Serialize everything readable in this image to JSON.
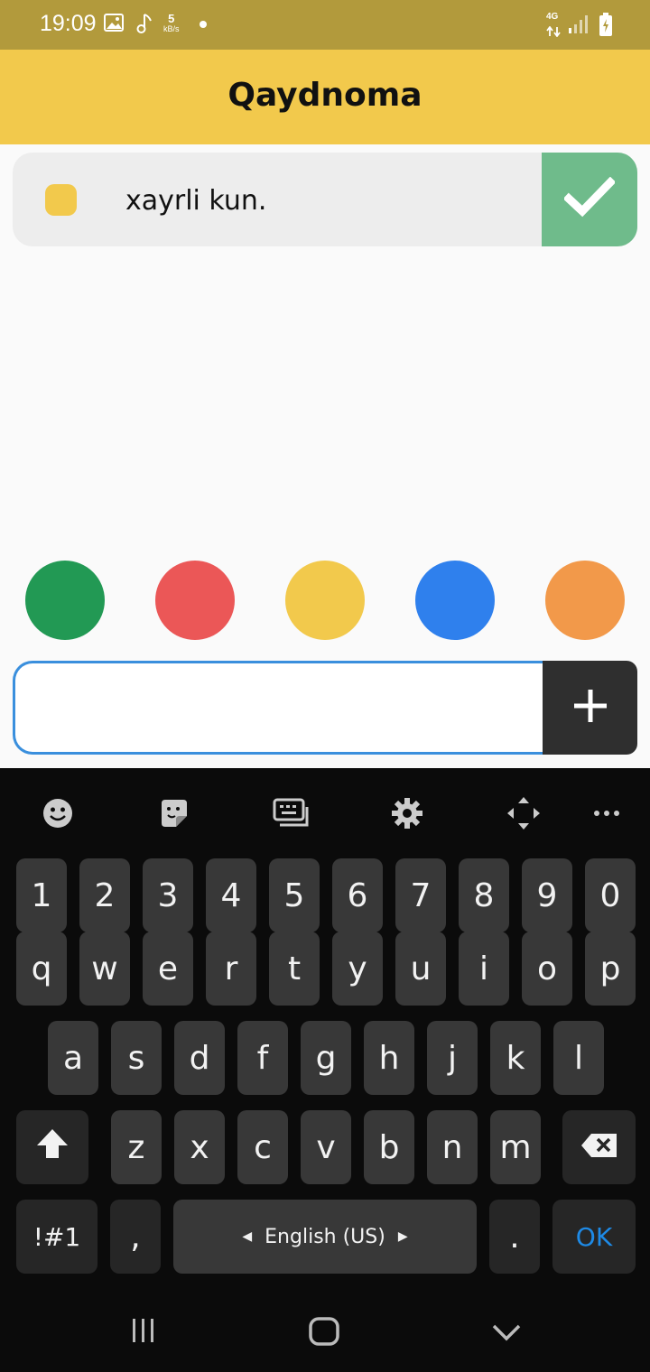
{
  "status_bar": {
    "time": "19:09",
    "net_speed_value": "5",
    "net_speed_unit": "kB/s",
    "network_type": "4G",
    "icons": [
      "image-icon",
      "music-note-icon",
      "notification-dot-icon",
      "signal-icon",
      "battery-charging-icon"
    ]
  },
  "app": {
    "title": "Qaydnoma"
  },
  "notes": [
    {
      "text": "xayrli kun.",
      "color": "#f2c94c",
      "done": true
    }
  ],
  "color_picker": {
    "colors": [
      "#229954",
      "#eb5757",
      "#f2c94c",
      "#2f80ed",
      "#f2994a"
    ]
  },
  "input": {
    "value": "",
    "placeholder": ""
  },
  "add_button": {
    "icon": "plus-icon"
  },
  "keyboard": {
    "toolbar": [
      "emoji-icon",
      "sticker-icon",
      "keyboard-mode-icon",
      "settings-icon",
      "move-icon",
      "more-icon"
    ],
    "row_numbers": [
      "1",
      "2",
      "3",
      "4",
      "5",
      "6",
      "7",
      "8",
      "9",
      "0"
    ],
    "row_top": [
      "q",
      "w",
      "e",
      "r",
      "t",
      "y",
      "u",
      "i",
      "o",
      "p"
    ],
    "row_middle": [
      "a",
      "s",
      "d",
      "f",
      "g",
      "h",
      "j",
      "k",
      "l"
    ],
    "row_bottom": [
      "z",
      "x",
      "c",
      "v",
      "b",
      "n",
      "m"
    ],
    "symbols_label": "!#1",
    "comma_label": ",",
    "space_label": "English (US)",
    "period_label": ".",
    "ok_label": "OK"
  },
  "nav_bar": {
    "icons": [
      "recent-apps-icon",
      "home-icon",
      "back-icon"
    ]
  },
  "theme": {
    "status_bar": "#b29a3c",
    "app_bar": "#f2c94c",
    "done_green": "#6fbb8b",
    "input_border": "#3a8fdd",
    "ok_blue": "#1e8ae6"
  }
}
